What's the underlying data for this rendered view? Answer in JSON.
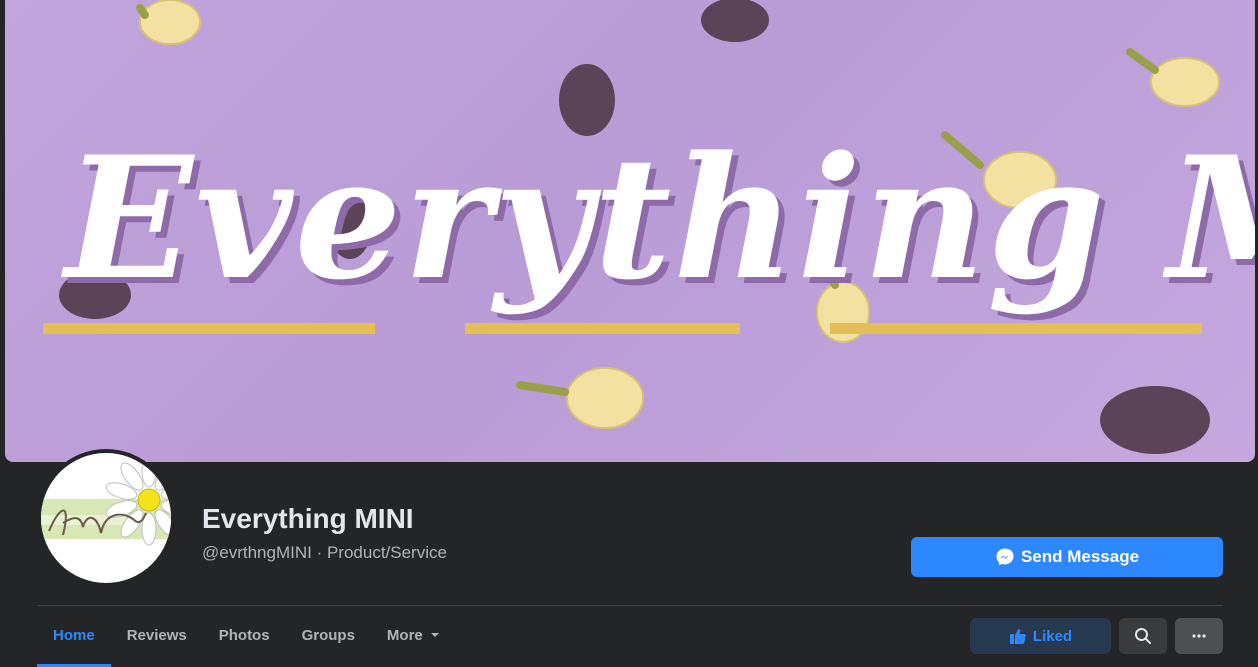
{
  "cover": {
    "title": "Everything Mini"
  },
  "page": {
    "name": "Everything MINI",
    "subtitle": "@evrthngMINI · Product/Service"
  },
  "actions": {
    "send_message": "Send Message",
    "liked": "Liked"
  },
  "tabs": [
    {
      "label": "Home",
      "active": true
    },
    {
      "label": "Reviews"
    },
    {
      "label": "Photos"
    },
    {
      "label": "Groups"
    },
    {
      "label": "More"
    }
  ],
  "colors": {
    "accent": "#2d88ff",
    "background": "#242526",
    "cover": "#c2a5dc",
    "underline": "#e7be55",
    "liked_bg": "#263951"
  },
  "icons": [
    "messenger-icon",
    "thumbs-up-icon",
    "search-icon",
    "ellipsis-icon",
    "caret-down-icon",
    "daisy-logo-icon"
  ]
}
